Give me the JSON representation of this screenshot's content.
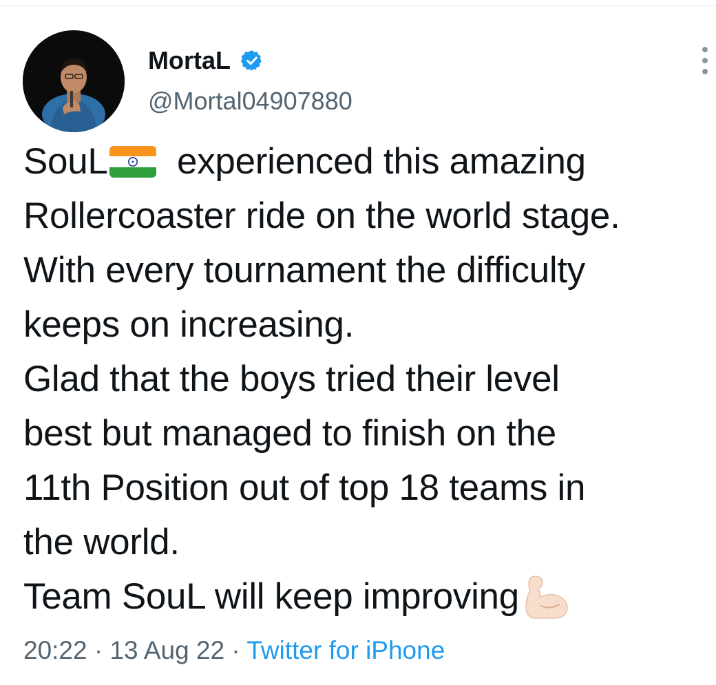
{
  "author": {
    "display_name": "MortaL",
    "handle": "@Mortal04907880",
    "verified": true,
    "verified_icon": "verified-badge-icon",
    "accent_color": "#1d9bf0"
  },
  "tweet": {
    "lines": [
      {
        "before": "SouL",
        "emoji": "india-flag-icon",
        "after": " experienced this amazing"
      },
      {
        "text": "Rollercoaster ride on the world stage."
      },
      {
        "text": "With every tournament the difficulty"
      },
      {
        "text": "keeps on increasing."
      },
      {
        "text": "Glad that the boys tried their level"
      },
      {
        "text": "best but managed to finish on the"
      },
      {
        "text": "11th Position out of top 18 teams in"
      },
      {
        "text": "the world."
      },
      {
        "before": "Team SouL will keep improving",
        "emoji": "flexed-biceps-icon"
      }
    ]
  },
  "meta": {
    "time": "20:22",
    "separator": " · ",
    "date": "13 Aug 22",
    "source": "Twitter for iPhone"
  },
  "menu_icon": "more-options-icon"
}
